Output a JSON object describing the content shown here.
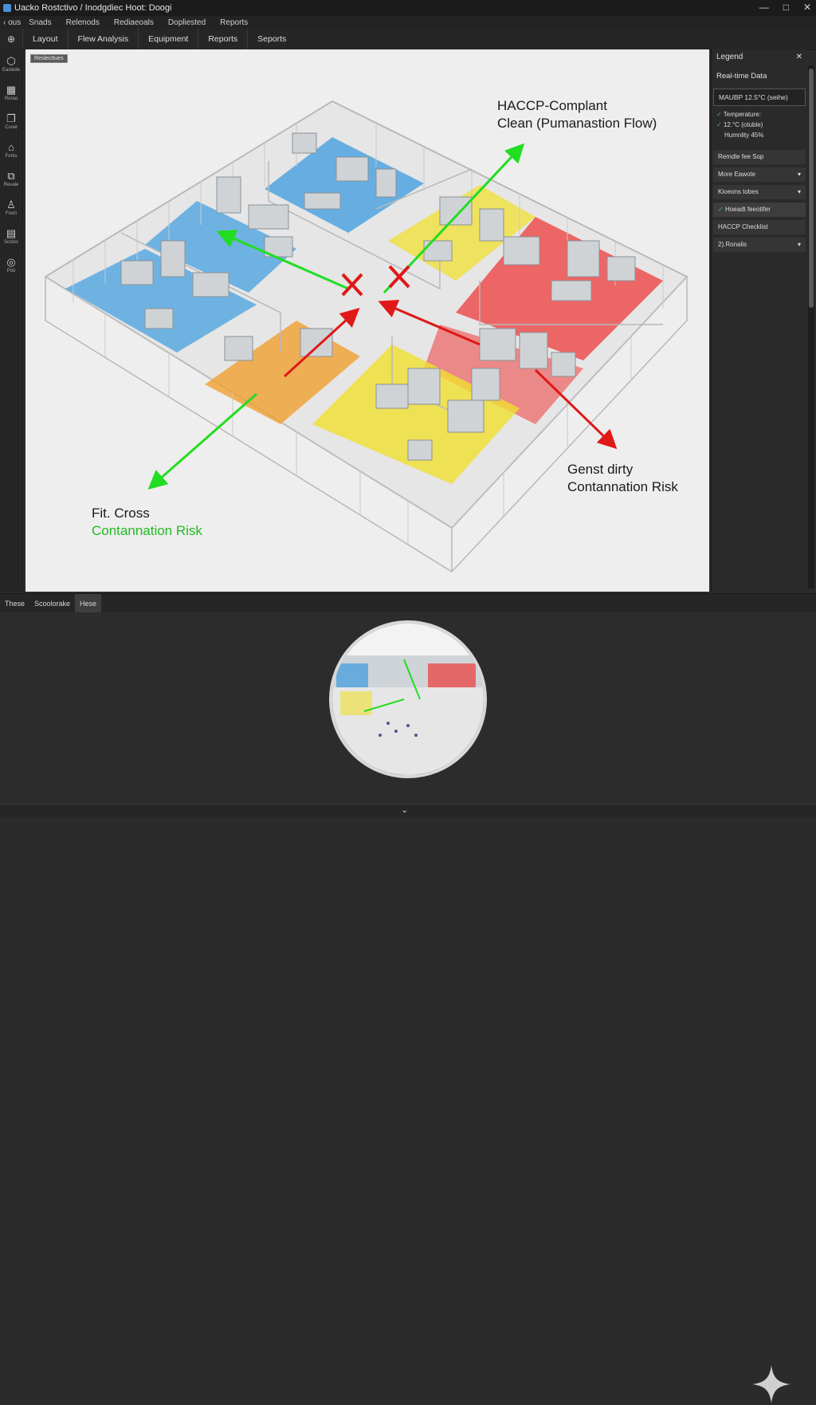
{
  "window": {
    "title": "Uacko Rostctivo / Inodgdiec Hoot: Doogi",
    "controls": [
      "—",
      "□",
      "✕"
    ]
  },
  "menu": {
    "back_label": "‹ ous",
    "items": [
      "Snads",
      "Relenods",
      "Rediaeoals",
      "Dopliested",
      "Reports"
    ]
  },
  "tabs": [
    "Layout",
    "Flew Analysis",
    "Equipment",
    "Reports",
    "Seports"
  ],
  "toolbar": [
    {
      "icon": "hexagon-icon",
      "glyph": "⬡",
      "label": "Eastede"
    },
    {
      "icon": "grid-icon",
      "glyph": "▦",
      "label": "Rorao"
    },
    {
      "icon": "copy-icon",
      "glyph": "❐",
      "label": "Cuset"
    },
    {
      "icon": "lock-icon",
      "glyph": "⌂",
      "label": "Forks"
    },
    {
      "icon": "layers-icon",
      "glyph": "⧉",
      "label": "Revale"
    },
    {
      "icon": "person-icon",
      "glyph": "♙",
      "label": "Foort"
    },
    {
      "icon": "box-icon",
      "glyph": "▤",
      "label": "Scolos"
    },
    {
      "icon": "pin-icon",
      "glyph": "◎",
      "label": "Poti"
    }
  ],
  "canvas": {
    "tag": "Reslecttues",
    "clean_flow_title_1": "HACCP-Complant",
    "clean_flow_title_2": "Clean (Pumanastion Flow)",
    "cross_risk_1": "Fit. Cross",
    "cross_risk_2": "Contannation Risk",
    "dirty_risk_1": "Genst dirty",
    "dirty_risk_2": "Contannation Risk"
  },
  "legend": {
    "title": "Legend",
    "section": "Real-time Data",
    "readout": "MAUBP  12.5°C  (seihe)",
    "temp_label": "Temperature:",
    "temp_value": "12.°C  (otuble)",
    "humidity": "Humnlity 45%",
    "rows": [
      {
        "label": "Remdle fee Sop",
        "arrow": ""
      },
      {
        "label": "More Eawote",
        "arrow": "▾"
      },
      {
        "label": "Kioeons tobes",
        "arrow": "▾"
      },
      {
        "label": "Hoeadt feeotifer",
        "arrow": "",
        "check": "✓"
      },
      {
        "label": "HACCP Checklist",
        "arrow": ""
      },
      {
        "label": "2).Ronalis",
        "arrow": "▾"
      }
    ]
  },
  "bottom_tabs": [
    "These",
    "Scoolorake",
    "Hese"
  ],
  "colors": {
    "clean_flow": "#22dd22",
    "dirty_flow": "#e01818",
    "zone_blue": "#3b9be0",
    "zone_yellow": "#f0e030",
    "zone_red": "#ee3b3b",
    "zone_orange": "#f0a030"
  }
}
